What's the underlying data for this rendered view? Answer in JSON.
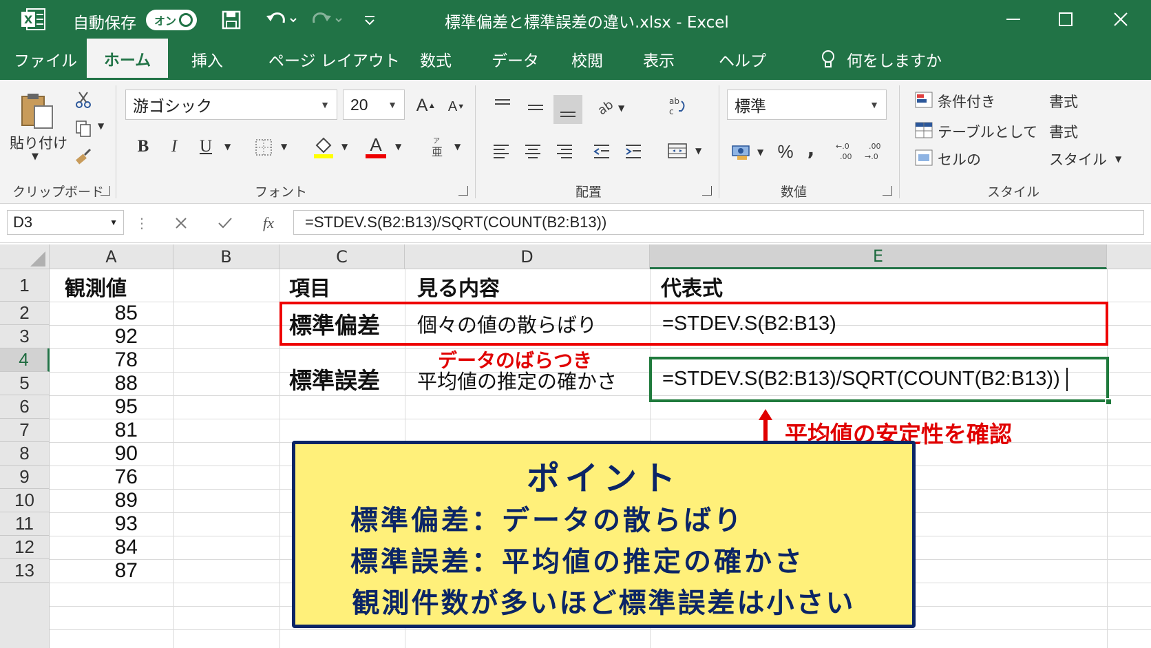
{
  "titlebar": {
    "autosave_label": "自動保存",
    "autosave_state": "オン",
    "title": "標準偏差と標準誤差の違い.xlsx  -  Excel"
  },
  "tabs": [
    "ファイル",
    "ホーム",
    "挿入",
    "ページ レイアウト",
    "数式",
    "データ",
    "校閲",
    "表示",
    "ヘルプ"
  ],
  "tell_me": "何をしますか",
  "ribbon": {
    "clipboard": {
      "paste": "貼り付け",
      "label": "クリップボード"
    },
    "font": {
      "name": "游ゴシック",
      "size": "20",
      "label": "フォント",
      "bold": "B",
      "italic": "I",
      "underline": "U",
      "color_letter": "A",
      "grow": "A",
      "shrink": "A"
    },
    "alignment": {
      "label": "配置"
    },
    "number": {
      "format": "標準",
      "percent": "%",
      "comma": ",",
      "label": "数値"
    },
    "styles": {
      "conditional": "条件付き",
      "conditional2": "書式",
      "table": "テーブルとして",
      "table2": "書式",
      "cell": "セルの",
      "cell2": "スタイル",
      "label": "スタイル"
    }
  },
  "formula_bar": {
    "name_box": "D3",
    "formula": "=STDEV.S(B2:B13)/SQRT(COUNT(B2:B13))",
    "fx": "fx"
  },
  "columns": [
    "A",
    "B",
    "C",
    "D",
    "E"
  ],
  "rows": [
    "1",
    "2",
    "3",
    "4",
    "5",
    "6",
    "7",
    "8",
    "9",
    "10",
    "11",
    "12",
    "13"
  ],
  "sheet": {
    "a1": "観測値",
    "values": [
      "85",
      "92",
      "78",
      "88",
      "95",
      "81",
      "90",
      "76",
      "89",
      "93",
      "84",
      "87"
    ],
    "header": {
      "item": "項目",
      "content": "見る内容",
      "formula": "代表式"
    },
    "sd_row": {
      "item": "標準偏差",
      "content": "個々の値の散らばり",
      "formula": "=STDEV.S(B2:B13)"
    },
    "se_row": {
      "item": "標準誤差",
      "content": "平均値の推定の確かさ",
      "formula": "=STDEV.S(B2:B13)/SQRT(COUNT(B2:B13))"
    }
  },
  "annotations": {
    "data_spread": "データのばらつき",
    "mean_stability": "平均値の安定性を確認"
  },
  "point_box": {
    "title": "ポイント",
    "line1": "標準偏差：データの散らばり",
    "line2": "標準誤差：平均値の推定の確かさ",
    "line3": "観測件数が多いほど標準誤差は小さい"
  },
  "colors": {
    "excel_green": "#217346",
    "annotation_red": "#e00000",
    "point_bg": "#fff07a",
    "point_border": "#0b2566"
  }
}
